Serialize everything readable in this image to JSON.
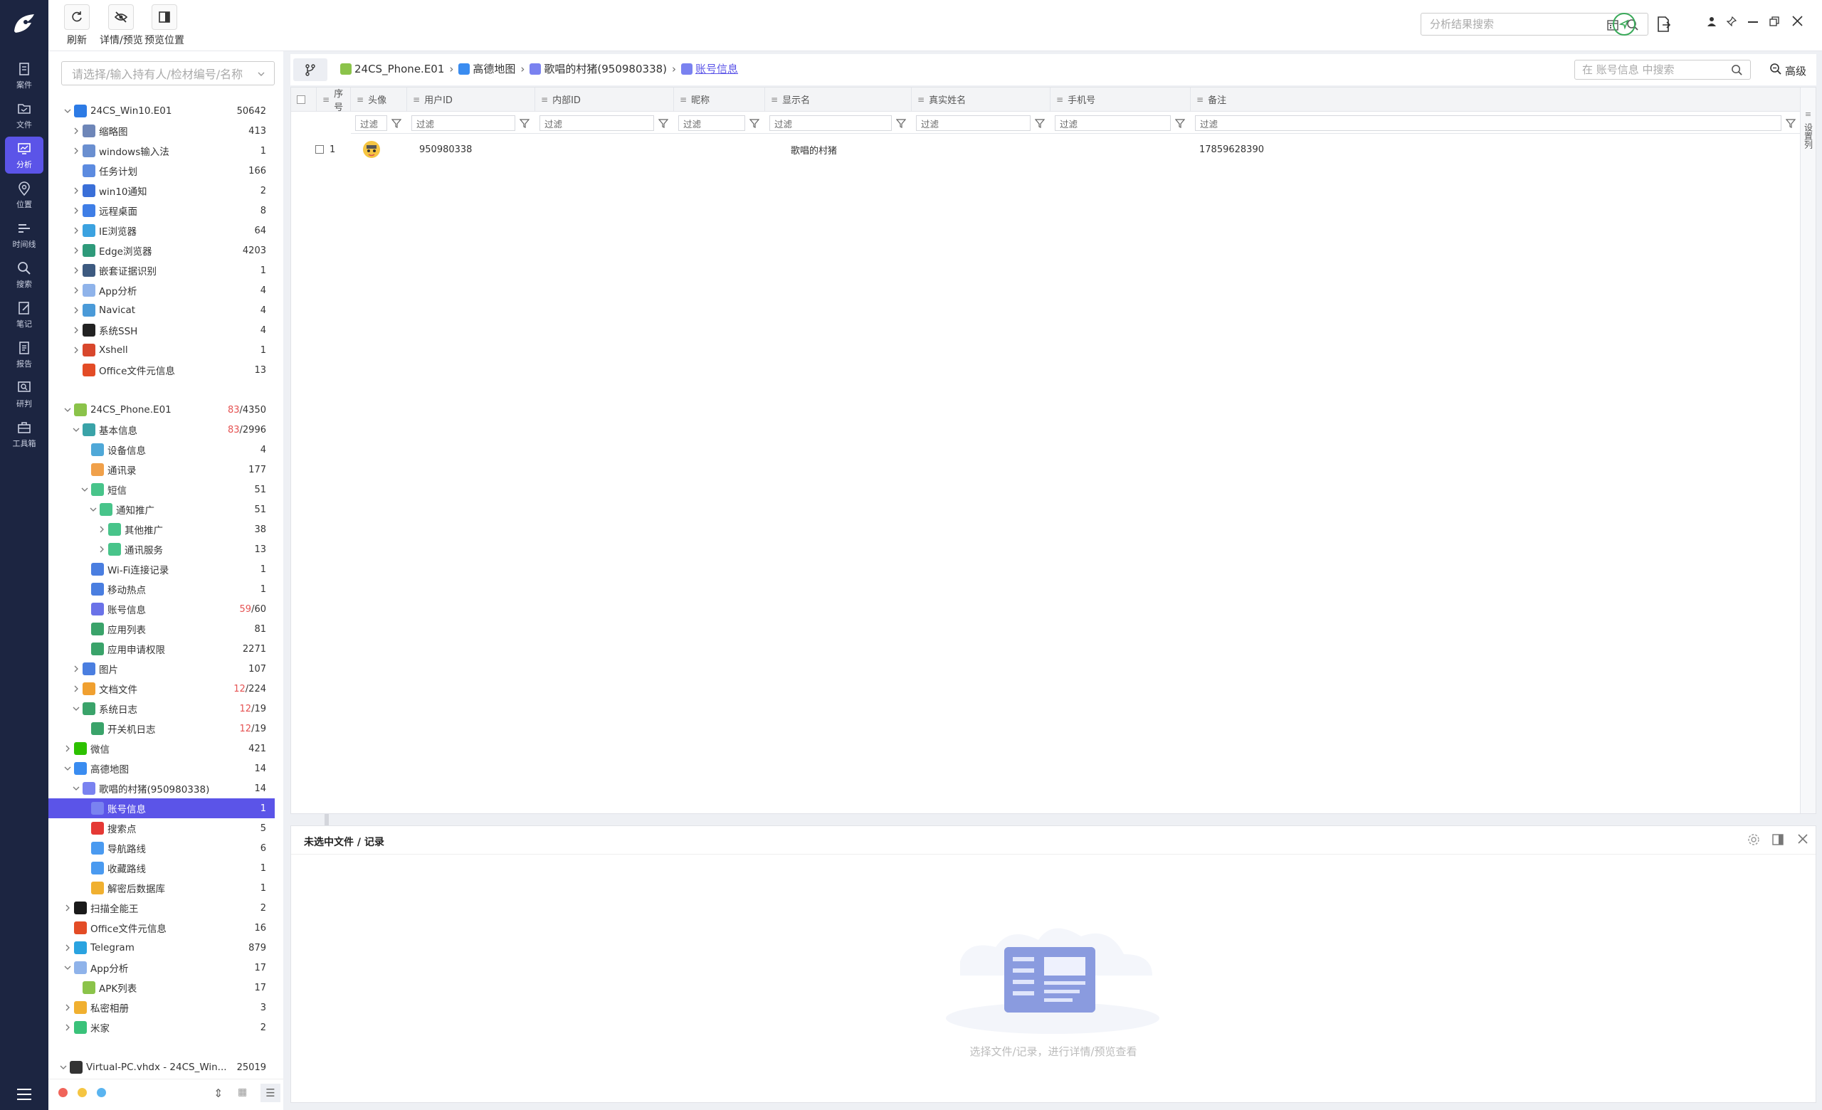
{
  "rail": {
    "items": [
      {
        "label": "案件",
        "icon": "case-icon"
      },
      {
        "label": "文件",
        "icon": "folder-icon"
      },
      {
        "label": "分析",
        "icon": "analysis-icon",
        "active": true
      },
      {
        "label": "位置",
        "icon": "location-pin-icon"
      },
      {
        "label": "时间线",
        "icon": "timeline-icon"
      },
      {
        "label": "搜索",
        "icon": "search-icon"
      },
      {
        "label": "笔记",
        "icon": "note-icon"
      },
      {
        "label": "报告",
        "icon": "report-icon"
      },
      {
        "label": "研判",
        "icon": "judge-icon"
      },
      {
        "label": "工具箱",
        "icon": "toolbox-icon"
      }
    ]
  },
  "toolbar": {
    "refresh": "刷新",
    "detail_preview": "详情/预览",
    "preview_position": "预览位置",
    "search_placeholder": "分析结果搜索"
  },
  "left": {
    "evidence_placeholder": "请选择/输入持有人/检材编号/名称"
  },
  "tree": [
    {
      "label": "24CS_Win10.E01",
      "count": "50642",
      "depth": 0,
      "arrow": "down",
      "icon": "windows-icon",
      "color": "#2d7be5"
    },
    {
      "label": "缩略图",
      "count": "413",
      "depth": 1,
      "arrow": "right",
      "icon": "thumbnail-icon",
      "color": "#6e86b8"
    },
    {
      "label": "windows输入法",
      "count": "1",
      "depth": 1,
      "arrow": "right",
      "icon": "keyboard-icon",
      "color": "#6a8fd0"
    },
    {
      "label": "任务计划",
      "count": "166",
      "depth": 1,
      "arrow": "",
      "icon": "task-schedule-icon",
      "color": "#5c8be0"
    },
    {
      "label": "win10通知",
      "count": "2",
      "depth": 1,
      "arrow": "right",
      "icon": "bell-icon",
      "color": "#3a6fd8"
    },
    {
      "label": "远程桌面",
      "count": "8",
      "depth": 1,
      "arrow": "right",
      "icon": "remote-desktop-icon",
      "color": "#3f7ee6"
    },
    {
      "label": "IE浏览器",
      "count": "64",
      "depth": 1,
      "arrow": "right",
      "icon": "ie-browser-icon",
      "color": "#3ba2e0"
    },
    {
      "label": "Edge浏览器",
      "count": "4203",
      "depth": 1,
      "arrow": "right",
      "icon": "edge-browser-icon",
      "color": "#2e9a7a"
    },
    {
      "label": "嵌套证据识别",
      "count": "1",
      "depth": 1,
      "arrow": "right",
      "icon": "monitor-icon",
      "color": "#3d5a80"
    },
    {
      "label": "App分析",
      "count": "4",
      "depth": 1,
      "arrow": "right",
      "icon": "app-grid-icon",
      "color": "#8fb3ea"
    },
    {
      "label": "Navicat",
      "count": "4",
      "depth": 1,
      "arrow": "right",
      "icon": "navicat-icon",
      "color": "#4a9ad8"
    },
    {
      "label": "系统SSH",
      "count": "4",
      "depth": 1,
      "arrow": "right",
      "icon": "ssh-icon",
      "color": "#222222"
    },
    {
      "label": "Xshell",
      "count": "1",
      "depth": 1,
      "arrow": "right",
      "icon": "xshell-icon",
      "color": "#d8472c"
    },
    {
      "label": "Office文件元信息",
      "count": "13",
      "depth": 1,
      "arrow": "",
      "icon": "office-icon",
      "color": "#e34c26"
    },
    {
      "label": "",
      "count": "",
      "depth": 0,
      "arrow": "",
      "icon": "",
      "color": ""
    },
    {
      "label": "24CS_Phone.E01",
      "count_red": "83",
      "count": "/4350",
      "depth": 0,
      "arrow": "down",
      "icon": "android-icon",
      "color": "#8bc34a"
    },
    {
      "label": "基本信息",
      "count_red": "83",
      "count": "/2996",
      "depth": 1,
      "arrow": "down",
      "icon": "basic-info-icon",
      "color": "#3aa3a8"
    },
    {
      "label": "设备信息",
      "count": "4",
      "depth": 2,
      "arrow": "",
      "icon": "device-icon",
      "color": "#4fa8d8"
    },
    {
      "label": "通讯录",
      "count": "177",
      "depth": 2,
      "arrow": "",
      "icon": "contacts-icon",
      "color": "#f0a04a"
    },
    {
      "label": "短信",
      "count": "51",
      "depth": 2,
      "arrow": "down",
      "icon": "sms-icon",
      "color": "#48c48a"
    },
    {
      "label": "通知推广",
      "count": "51",
      "depth": 3,
      "arrow": "down",
      "icon": "sms-icon",
      "color": "#48c48a"
    },
    {
      "label": "其他推广",
      "count": "38",
      "depth": 4,
      "arrow": "right",
      "icon": "sms-icon",
      "color": "#48c48a"
    },
    {
      "label": "通讯服务",
      "count": "13",
      "depth": 4,
      "arrow": "right",
      "icon": "sms-icon",
      "color": "#48c48a"
    },
    {
      "label": "Wi-Fi连接记录",
      "count": "1",
      "depth": 2,
      "arrow": "",
      "icon": "wifi-icon",
      "color": "#4a7ee0"
    },
    {
      "label": "移动热点",
      "count": "1",
      "depth": 2,
      "arrow": "",
      "icon": "hotspot-icon",
      "color": "#4a7ee0"
    },
    {
      "label": "账号信息",
      "count_red": "59",
      "count": "/60",
      "depth": 2,
      "arrow": "",
      "icon": "account-icon",
      "color": "#6a72e8"
    },
    {
      "label": "应用列表",
      "count": "81",
      "depth": 2,
      "arrow": "",
      "icon": "list-icon",
      "color": "#3aa36a"
    },
    {
      "label": "应用申请权限",
      "count": "2271",
      "depth": 2,
      "arrow": "",
      "icon": "list-icon",
      "color": "#3aa36a"
    },
    {
      "label": "图片",
      "count": "107",
      "depth": 1,
      "arrow": "right",
      "icon": "image-icon",
      "color": "#4a7ee0"
    },
    {
      "label": "文档文件",
      "count_red": "12",
      "count": "/224",
      "depth": 1,
      "arrow": "right",
      "icon": "document-icon",
      "color": "#f0a030"
    },
    {
      "label": "系统日志",
      "count_red": "12",
      "count": "/19",
      "depth": 1,
      "arrow": "down",
      "icon": "log-icon",
      "color": "#3aa36a"
    },
    {
      "label": "开关机日志",
      "count_red": "12",
      "count": "/19",
      "depth": 2,
      "arrow": "",
      "icon": "log-icon",
      "color": "#3aa36a"
    },
    {
      "label": "微信",
      "count": "421",
      "depth": 0,
      "arrow": "right",
      "icon": "wechat-icon",
      "color": "#2dc100"
    },
    {
      "label": "高德地图",
      "count": "14",
      "depth": 0,
      "arrow": "down",
      "icon": "amap-icon",
      "color": "#3a8cf0"
    },
    {
      "label": "歌唱的村猪(950980338)",
      "count": "14",
      "depth": 1,
      "arrow": "down",
      "icon": "user-icon",
      "color": "#7a82f0"
    },
    {
      "label": "账号信息",
      "count": "1",
      "depth": 2,
      "arrow": "",
      "icon": "account-icon",
      "color": "#7a82f0",
      "selected": true
    },
    {
      "label": "搜索点",
      "count": "5",
      "depth": 2,
      "arrow": "",
      "icon": "location-pin-icon",
      "color": "#e53935"
    },
    {
      "label": "导航路线",
      "count": "6",
      "depth": 2,
      "arrow": "",
      "icon": "route-icon",
      "color": "#4a9af0"
    },
    {
      "label": "收藏路线",
      "count": "1",
      "depth": 2,
      "arrow": "",
      "icon": "route-icon",
      "color": "#4a9af0"
    },
    {
      "label": "解密后数据库",
      "count": "1",
      "depth": 2,
      "arrow": "",
      "icon": "database-icon",
      "color": "#f0b030"
    },
    {
      "label": "扫描全能王",
      "count": "2",
      "depth": 0,
      "arrow": "right",
      "icon": "camscanner-icon",
      "color": "#1a1a1a"
    },
    {
      "label": "Office文件元信息",
      "count": "16",
      "depth": 0,
      "arrow": "",
      "icon": "office-icon",
      "color": "#e34c26"
    },
    {
      "label": "Telegram",
      "count": "879",
      "depth": 0,
      "arrow": "right",
      "icon": "telegram-icon",
      "color": "#2aa3e0"
    },
    {
      "label": "App分析",
      "count": "17",
      "depth": 0,
      "arrow": "down",
      "icon": "app-grid-icon",
      "color": "#8fb3ea"
    },
    {
      "label": "APK列表",
      "count": "17",
      "depth": 1,
      "arrow": "",
      "icon": "android-icon",
      "color": "#8bc34a"
    },
    {
      "label": "私密相册",
      "count": "3",
      "depth": 0,
      "arrow": "right",
      "icon": "private-album-icon",
      "color": "#f0b030"
    },
    {
      "label": "米家",
      "count": "2",
      "depth": 0,
      "arrow": "right",
      "icon": "mijia-icon",
      "color": "#3ac27a"
    },
    {
      "label": "",
      "count": "",
      "depth": 0,
      "arrow": "",
      "icon": "",
      "color": ""
    },
    {
      "label": "Virtual-PC.vhdx - 24CS_Win...",
      "count": "25019",
      "depth": -1,
      "arrow": "down",
      "icon": "linux-icon",
      "color": "#333333"
    }
  ],
  "breadcrumb": [
    {
      "label": "24CS_Phone.E01",
      "icon": "android-icon",
      "color": "#8bc34a"
    },
    {
      "label": "高德地图",
      "icon": "amap-icon",
      "color": "#3a8cf0"
    },
    {
      "label": "歌唱的村猪(950980338)",
      "icon": "user-icon",
      "color": "#7a82f0"
    },
    {
      "label": "账号信息",
      "icon": "account-icon",
      "color": "#7a82f0",
      "current": true
    }
  ],
  "table": {
    "search_placeholder": "在 账号信息 中搜索",
    "advanced": "高级",
    "set_columns": "设置列",
    "filter_placeholder": "过滤",
    "columns": [
      "序号",
      "头像",
      "用户ID",
      "内部ID",
      "昵称",
      "显示名",
      "真实姓名",
      "手机号",
      "备注"
    ],
    "rows": [
      {
        "index": "1",
        "user_id": "950980338",
        "internal_id": "",
        "nickname": "歌唱的村猪",
        "display_name": "",
        "real_name": "",
        "phone": "17859628390",
        "remark": ""
      }
    ]
  },
  "detail": {
    "title": "未选中文件 / 记录",
    "empty_hint": "选择文件/记录，进行详情/预览查看"
  }
}
